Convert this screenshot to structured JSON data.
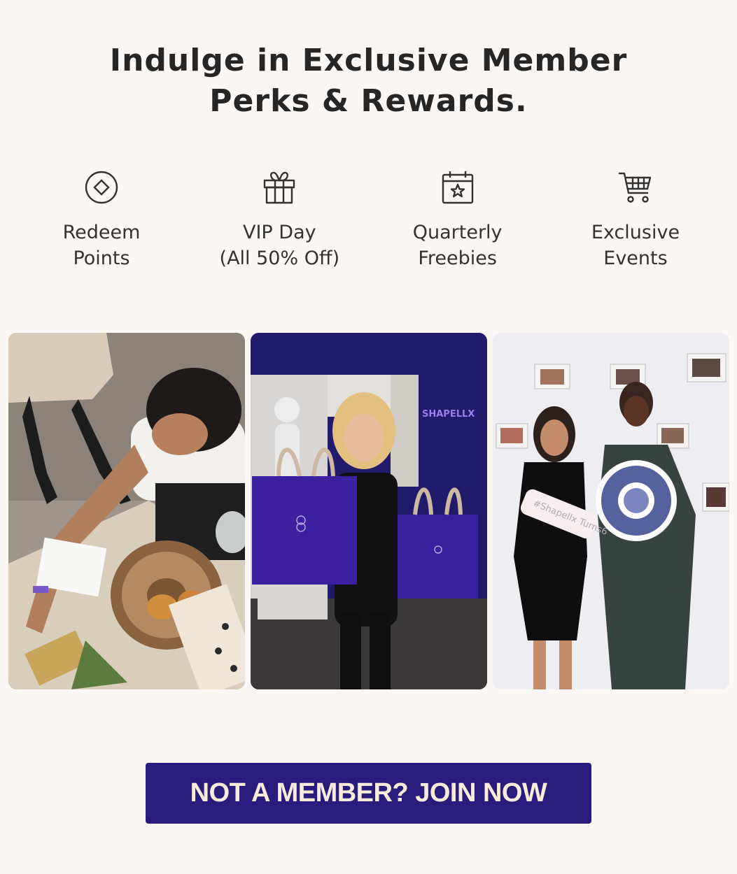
{
  "headline": {
    "line1": "Indulge in Exclusive Member",
    "line2": "Perks & Rewards."
  },
  "perks": [
    {
      "icon": "diamond-coin-icon",
      "line1": "Redeem",
      "line2": "Points"
    },
    {
      "icon": "gift-icon",
      "line1": "VIP Day",
      "line2": "(All 50% Off)"
    },
    {
      "icon": "calendar-star-icon",
      "line1": "Quarterly",
      "line2": "Freebies"
    },
    {
      "icon": "shopping-cart-icon",
      "line1": "Exclusive",
      "line2": "Events"
    }
  ],
  "photos": [
    {
      "name": "event-food-table-photo"
    },
    {
      "name": "shopping-bags-photo",
      "bag_brand": "SHAPELLX"
    },
    {
      "name": "members-gear-sign-photo",
      "sign_text": "#Shapellx Turns6"
    }
  ],
  "cta": {
    "label": "NOT A MEMBER? JOIN NOW",
    "color": "#2a1c7d",
    "text_color": "#f7ecd9"
  }
}
